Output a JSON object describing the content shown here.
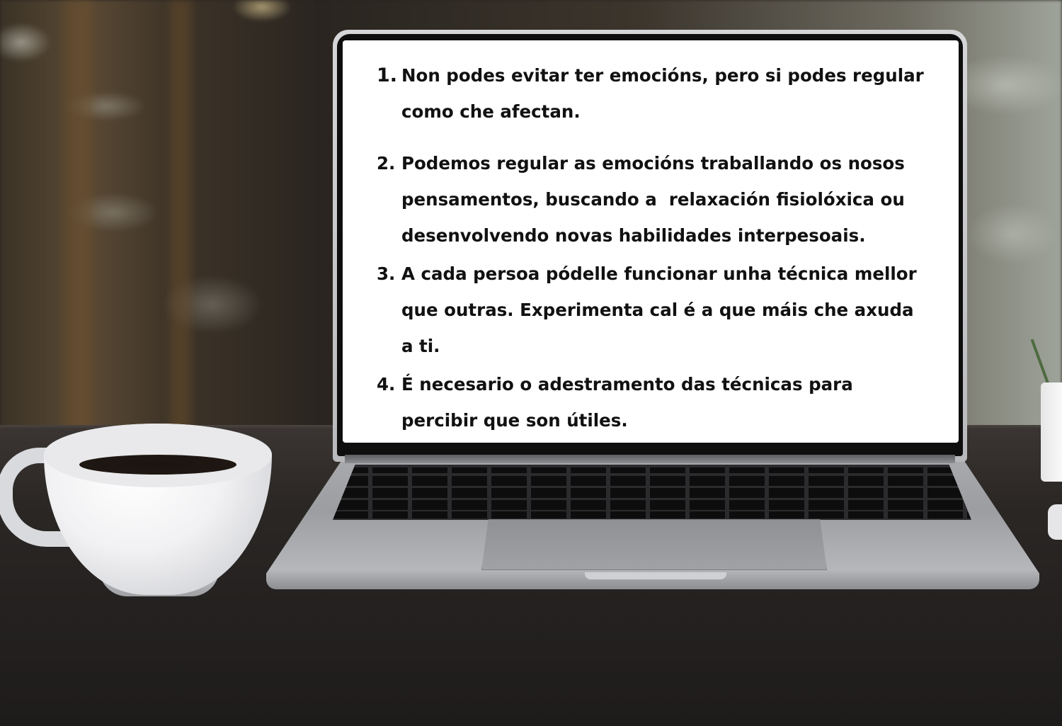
{
  "scene": {
    "objects": [
      "laptop",
      "coffee cup",
      "desk",
      "plant pot"
    ]
  },
  "screen": {
    "items": [
      {
        "number": "1.",
        "text": "Non podes evitar ter emocións, pero si podes regular\ncomo che afectan."
      },
      {
        "number": "2.",
        "text": "Podemos regular as emocións traballando os nosos\npensamentos, buscando a  relaxación fisiolóxica ou\ndesenvolvendo novas habilidades interpesoais."
      },
      {
        "number": "3.",
        "text": "A cada persoa pódelle funcionar unha técnica mellor\nque outras. Experimenta cal é a que máis che axuda\na ti."
      },
      {
        "number": "4.",
        "text": "É necesario o adestramento das técnicas para\npercibir que son útiles."
      }
    ]
  }
}
